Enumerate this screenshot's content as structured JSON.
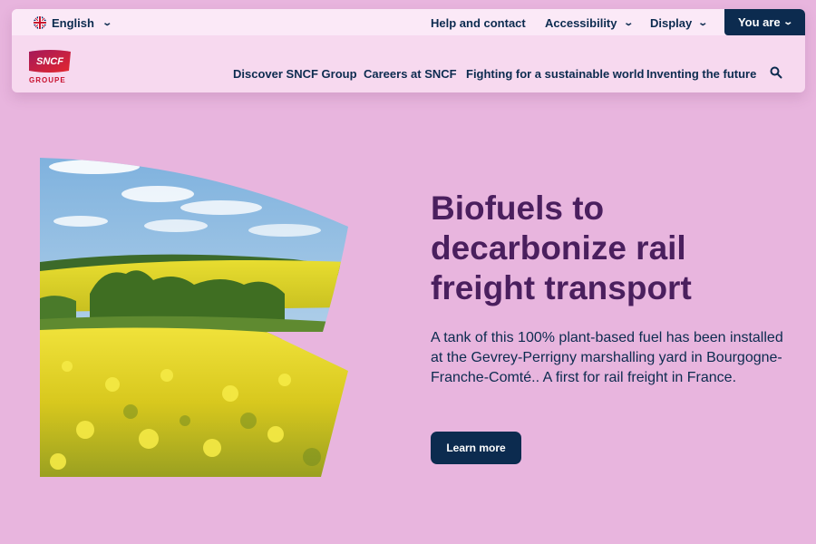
{
  "topbar": {
    "language": "English",
    "links": [
      "Help and contact",
      "Accessibility",
      "Display"
    ],
    "you_are": "You are"
  },
  "logo": {
    "mark": "SNCF",
    "subtitle": "GROUPE"
  },
  "nav": {
    "items": [
      "Discover SNCF Group",
      "Careers at SNCF",
      "Fighting for a sustainable world",
      "Inventing the future"
    ]
  },
  "hero": {
    "title_lines": [
      "Biofuels to",
      "decarbonize rail",
      "freight transport"
    ],
    "description": "A tank of this 100% plant-based fuel has been installed at the Gevrey-Perrigny marshalling yard in Bourgogne-Franche-Comté.. A first for rail freight in France.",
    "cta": "Learn more"
  },
  "colors": {
    "background": "#e8b5de",
    "navy": "#0c2b4f",
    "title_purple": "#4a1f5e",
    "brand_red": "#c8102e"
  },
  "icons": [
    "uk-flag-icon",
    "chevron-down-icon",
    "search-icon"
  ]
}
